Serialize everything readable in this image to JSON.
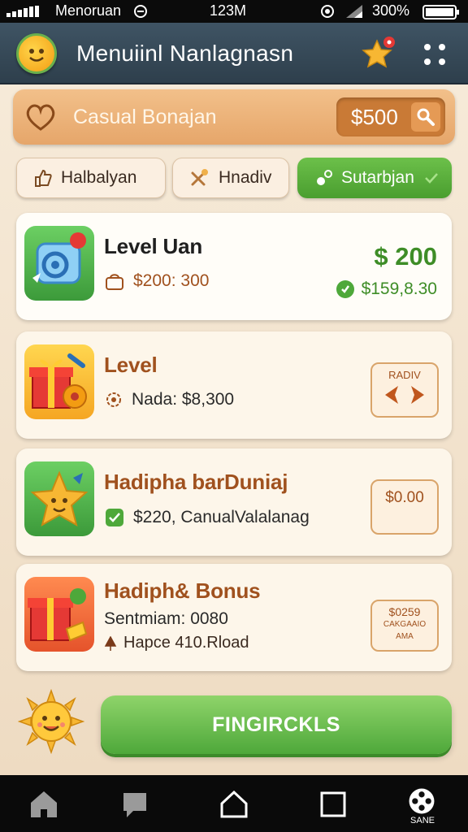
{
  "status": {
    "left": "Menoruan",
    "center": "123M",
    "battery": "300%"
  },
  "app": {
    "title": "Menuiinl Nanlagnasn"
  },
  "search": {
    "placeholder": "Casual Bonajan",
    "amount": "$500"
  },
  "chips": [
    {
      "label": "Halbalyan"
    },
    {
      "label": "Hnadiv"
    },
    {
      "label": "Sutarbjan"
    }
  ],
  "cards": [
    {
      "title": "Level Uan",
      "subtitle": "$200: 300",
      "price_big": "$ 200",
      "price_small": "$159,8.30"
    },
    {
      "title": "Level",
      "subtitle": "Nada: $8,300",
      "tag": "RADIV"
    },
    {
      "title": "Hadipha barDuniaj",
      "subtitle": "$220, CanualValalanag",
      "tag": "$0.00"
    },
    {
      "title": "Hadiph& Bonus",
      "subtitle": "Sentmiam: 0080",
      "subtitle2": "Hapce 410.Rload",
      "tag_line1": "$0259",
      "tag_line2": "CAKGAAIO",
      "tag_line3": "AMA"
    }
  ],
  "cta": {
    "label": "FINGIRCKLS"
  },
  "nav": {
    "last_label": "SANE"
  },
  "colors": {
    "accent_green": "#4ea83a",
    "header": "#2e3f4c",
    "search_orange": "#e6a66a",
    "price_green": "#3e8d27",
    "title_brown": "#a0511e"
  },
  "icons": [
    "signal-icon",
    "wifi-icon",
    "battery-icon",
    "app-logo-icon",
    "star-badge-icon",
    "more-icon",
    "heart-icon",
    "search-icon",
    "gift-icon",
    "home-icon",
    "chat-icon",
    "square-icon"
  ]
}
